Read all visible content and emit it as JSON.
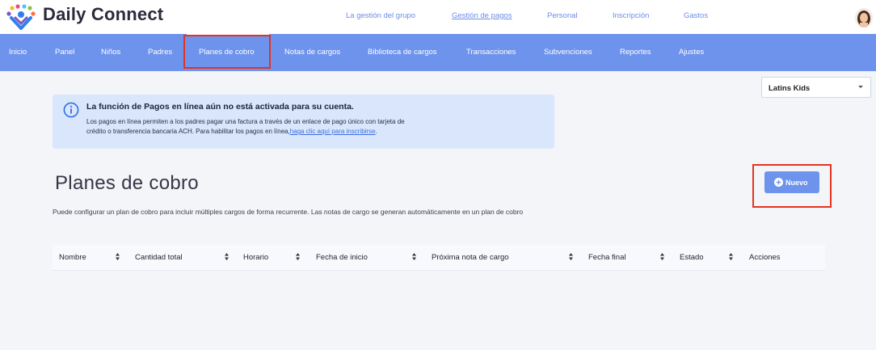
{
  "app": {
    "brand": "Daily Connect"
  },
  "top_nav": [
    {
      "label": "La gestión del grupo"
    },
    {
      "label": "Gestión de pagos"
    },
    {
      "label": "Personal"
    },
    {
      "label": "Inscripción"
    },
    {
      "label": "Gastos"
    }
  ],
  "main_nav": [
    {
      "label": "Inicio"
    },
    {
      "label": "Panel"
    },
    {
      "label": "Niños"
    },
    {
      "label": "Padres"
    },
    {
      "label": "Planes de cobro"
    },
    {
      "label": "Notas de cargos"
    },
    {
      "label": "Biblioteca de cargos"
    },
    {
      "label": "Transacciones"
    },
    {
      "label": "Subvenciones"
    },
    {
      "label": "Reportes"
    },
    {
      "label": "Ajustes"
    }
  ],
  "center_select": {
    "value": "Latins Kids"
  },
  "banner": {
    "title": "La función de Pagos en línea aún no está activada para su cuenta.",
    "text_1": "Los pagos en línea permiten a los padres pagar una factura a través de un enlace de pago único con tarjeta de",
    "text_2": "crédito o transferencia bancaria ACH. Para habilitar los pagos en línea,",
    "link": "haga clic aquí para inscribirse",
    "text_end": "."
  },
  "page": {
    "title": "Planes de cobro",
    "description": "Puede configurar un plan de cobro para incluir múltiples cargos de forma recurrente. Las notas de cargo se generan automáticamente en un plan de cobro",
    "new_button": "Nuevo"
  },
  "table": {
    "columns": [
      "Nombre",
      "Cantidad total",
      "Horario",
      "Fecha de inicio",
      "Próxima nota de cargo",
      "Fecha final",
      "Estado",
      "Acciones"
    ]
  },
  "colors": {
    "accent": "#6e93ed",
    "highlight": "#e5331f",
    "banner_bg": "#d9e6fb"
  }
}
